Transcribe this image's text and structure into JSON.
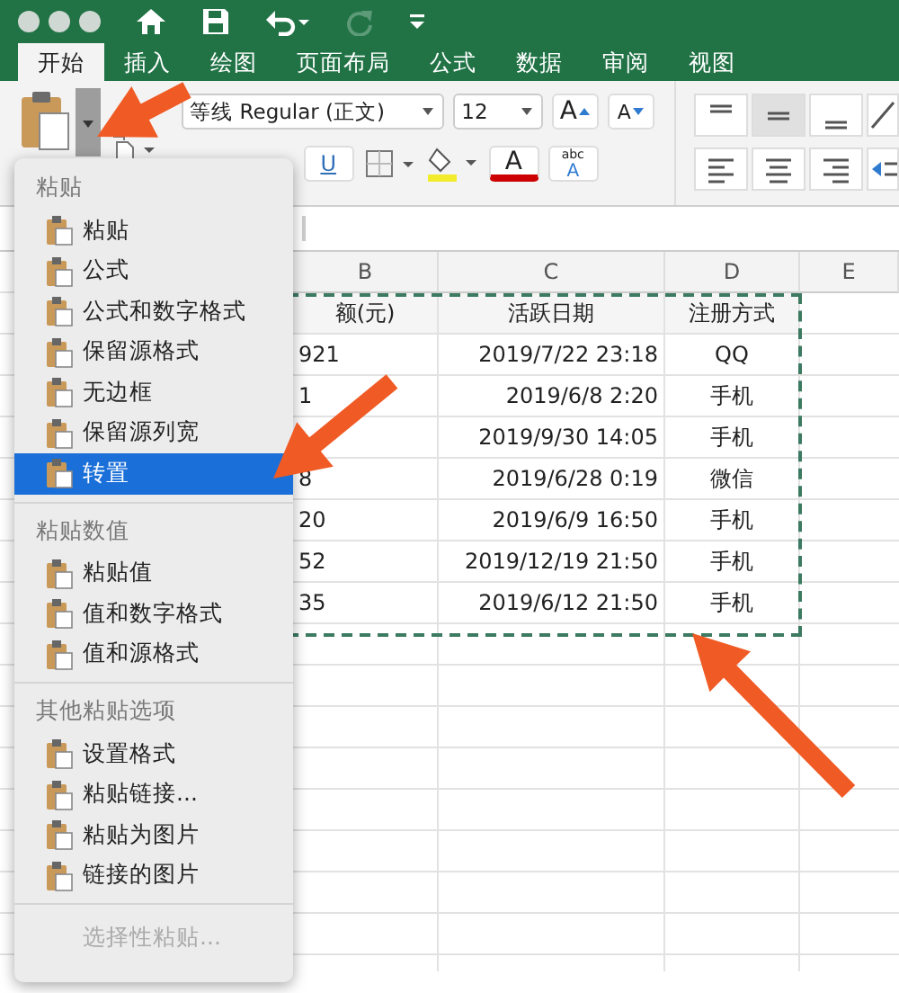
{
  "tabs": [
    {
      "label": "开始",
      "selected": true
    },
    {
      "label": "插入",
      "selected": false
    },
    {
      "label": "绘图",
      "selected": false
    },
    {
      "label": "页面布局",
      "selected": false
    },
    {
      "label": "公式",
      "selected": false
    },
    {
      "label": "数据",
      "selected": false
    },
    {
      "label": "审阅",
      "selected": false
    },
    {
      "label": "视图",
      "selected": false
    }
  ],
  "ribbon": {
    "font": "等线 Regular (正文)",
    "size": "12",
    "grow": "A",
    "shrink": "A",
    "underline": "U",
    "font_color": "A",
    "effect_top": "abc",
    "effect_bottom": "A"
  },
  "sheet": {
    "columns": [
      "B",
      "C",
      "D",
      "E"
    ],
    "header": [
      "额(元)",
      "活跃日期",
      "注册方式"
    ],
    "rows": [
      {
        "amount": "921",
        "date": "2019/7/22 23:18",
        "method": "QQ"
      },
      {
        "amount": "1",
        "date": "2019/6/8 2:20",
        "method": "手机"
      },
      {
        "date": "2019/9/30 14:05",
        "method": "手机"
      },
      {
        "amount": "8",
        "date": "2019/6/28 0:19",
        "method": "微信"
      },
      {
        "amount": "20",
        "date": "2019/6/9 16:50",
        "method": "手机"
      },
      {
        "amount": "52",
        "date": "2019/12/19 21:50",
        "method": "手机"
      },
      {
        "amount": "35",
        "date": "2019/6/12 21:50",
        "method": "手机"
      }
    ]
  },
  "paste_menu": {
    "sections": [
      {
        "title": "粘贴",
        "items": [
          {
            "label": "粘贴",
            "selected": false
          },
          {
            "label": "公式",
            "selected": false
          },
          {
            "label": "公式和数字格式",
            "selected": false
          },
          {
            "label": "保留源格式",
            "selected": false
          },
          {
            "label": "无边框",
            "selected": false
          },
          {
            "label": "保留源列宽",
            "selected": false
          },
          {
            "label": "转置",
            "selected": true
          }
        ]
      },
      {
        "title": "粘贴数值",
        "items": [
          {
            "label": "粘贴值",
            "selected": false
          },
          {
            "label": "值和数字格式",
            "selected": false
          },
          {
            "label": "值和源格式",
            "selected": false
          }
        ]
      },
      {
        "title": "其他粘贴选项",
        "items": [
          {
            "label": "设置格式",
            "selected": false
          },
          {
            "label": "粘贴链接...",
            "selected": false
          },
          {
            "label": "粘贴为图片",
            "selected": false
          },
          {
            "label": "链接的图片",
            "selected": false
          }
        ]
      }
    ],
    "footer": {
      "label": "选择性粘贴...",
      "disabled": true
    }
  }
}
